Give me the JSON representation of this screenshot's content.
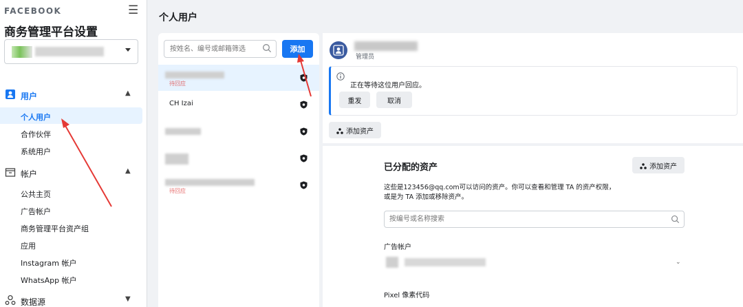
{
  "brand": "FACEBOOK",
  "sidebar": {
    "title": "商务管理平台设置",
    "sections": [
      {
        "label": "用户",
        "icon": "users-icon",
        "expanded": true,
        "items": [
          "个人用户",
          "合作伙伴",
          "系统用户"
        ]
      },
      {
        "label": "帐户",
        "icon": "accounts-icon",
        "expanded": true,
        "items": [
          "公共主页",
          "广告帐户",
          "商务管理平台资产组",
          "应用",
          "Instagram 帐户",
          "WhatsApp 帐户"
        ]
      },
      {
        "label": "数据源",
        "icon": "data-sources-icon",
        "expanded": false,
        "items": []
      }
    ],
    "active_item": "个人用户"
  },
  "page_title": "个人用户",
  "user_list": {
    "search_placeholder": "按姓名、编号或邮箱筛选",
    "add_label": "添加",
    "rows": [
      {
        "name": "",
        "status": "待回应",
        "selected": true
      },
      {
        "name": "CH Izai",
        "status": "",
        "selected": false
      },
      {
        "name": "",
        "status": "",
        "selected": false
      },
      {
        "name": "",
        "status": "",
        "selected": false
      },
      {
        "name": "",
        "status": "待回应",
        "selected": false
      }
    ]
  },
  "detail": {
    "role": "管理员",
    "notice_text": "正在等待这位用户回应。",
    "resend_label": "重发",
    "cancel_label": "取消",
    "add_asset_label": "添加资产",
    "assets_title": "已分配的资产",
    "assets_add_label": "添加资产",
    "assets_desc": "这些是123456@qq.com可以访问的资产。你可以查看和管理 TA 的资产权限，或是为 TA 添加或移除资产。",
    "assets_search_placeholder": "按编号或名称搜索",
    "ad_accounts_label": "广告帐户",
    "pixel_label": "Pixel 像素代码"
  },
  "colors": {
    "accent": "#1877f2",
    "active_bg": "#e7f3ff",
    "annotation": "#e53935"
  }
}
